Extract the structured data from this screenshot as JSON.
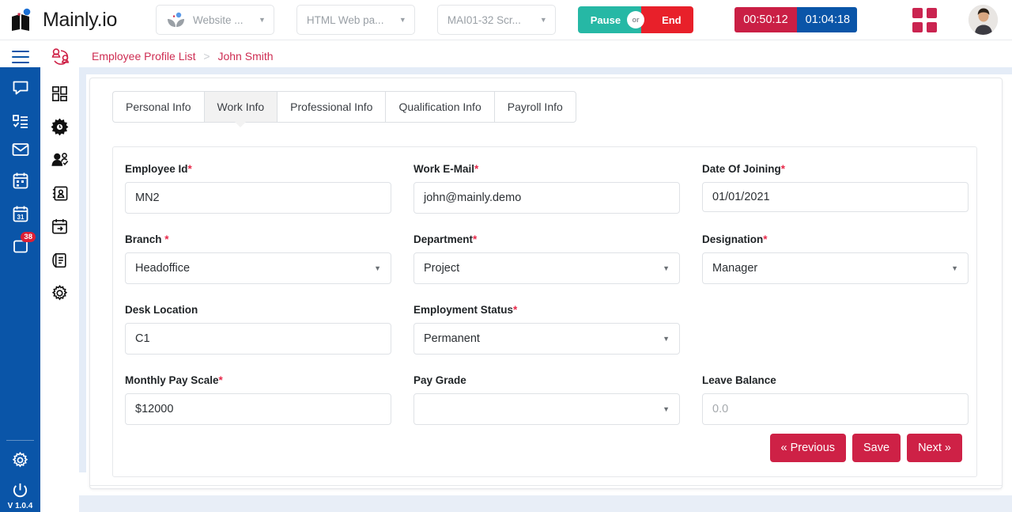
{
  "brand": {
    "name": "Mainly.io",
    "version": "V 1.0.4"
  },
  "topbar": {
    "selects": [
      {
        "name": "website-select",
        "label": "Website ...",
        "caret": "chevron-down-icon"
      },
      {
        "name": "task-type-select",
        "label": "HTML Web pa...",
        "caret": "chevron-down-icon"
      },
      {
        "name": "task-id-select",
        "label": "MAI01-32 Scr...",
        "caret": "chevron-down-icon"
      }
    ],
    "session": {
      "pause_label": "Pause",
      "or_label": "or",
      "end_label": "End"
    },
    "timers": {
      "elapsed": "00:50:12",
      "total": "01:04:18"
    },
    "apps_icon": "grid-apps-icon",
    "avatar": "user-avatar"
  },
  "sidebar": {
    "menu_icon": "hamburger-menu-icon",
    "logo_icon": "people-network-icon",
    "blue_items": [
      {
        "icon": "chat-bubble-icon",
        "label": "Chat"
      },
      {
        "icon": "task-list-icon",
        "label": "Tasks"
      },
      {
        "icon": "envelope-icon",
        "label": "Mail"
      },
      {
        "icon": "calendar-icon",
        "label": "Calendar"
      },
      {
        "icon": "calendar-31-icon",
        "label": "Schedule"
      },
      {
        "icon": "notes-icon",
        "label": "Notes",
        "badge": "38"
      }
    ],
    "white_items": [
      {
        "icon": "dashboard-grid-icon",
        "label": "Dashboard"
      },
      {
        "icon": "gear-clock-icon",
        "label": "Operations"
      },
      {
        "icon": "user-check-icon",
        "label": "Attendance"
      },
      {
        "icon": "id-card-icon",
        "label": "Employees"
      },
      {
        "icon": "calendar-leave-icon",
        "label": "Leave"
      },
      {
        "icon": "clipboard-icon",
        "label": "Reports"
      },
      {
        "icon": "settings-gear-icon",
        "label": "Settings"
      }
    ],
    "bottom_items": [
      {
        "icon": "settings-gear-icon",
        "label": "Settings"
      },
      {
        "icon": "power-icon",
        "label": "Logout"
      }
    ]
  },
  "breadcrumb": {
    "parent": "Employee Profile List",
    "separator": ">",
    "current": "John Smith"
  },
  "tabs": [
    {
      "label": "Personal Info",
      "active": false
    },
    {
      "label": "Work Info",
      "active": true
    },
    {
      "label": "Professional Info",
      "active": false
    },
    {
      "label": "Qualification Info",
      "active": false
    },
    {
      "label": "Payroll Info",
      "active": false
    }
  ],
  "form": {
    "employee_id": {
      "label": "Employee Id",
      "required": true,
      "value": "MN2",
      "type": "text"
    },
    "work_email": {
      "label": "Work E-Mail",
      "required": true,
      "value": "john@mainly.demo",
      "type": "text"
    },
    "date_of_joining": {
      "label": "Date Of Joining",
      "required": true,
      "value": "01/01/2021",
      "type": "text"
    },
    "branch": {
      "label": "Branch ",
      "required": true,
      "value": "Headoffice",
      "type": "select"
    },
    "department": {
      "label": "Department",
      "required": true,
      "value": "Project",
      "type": "select"
    },
    "designation": {
      "label": "Designation",
      "required": true,
      "value": "Manager",
      "type": "select"
    },
    "desk_location": {
      "label": "Desk Location",
      "required": false,
      "value": "C1",
      "type": "text"
    },
    "employment_status": {
      "label": "Employment Status",
      "required": true,
      "value": "Permanent",
      "type": "select"
    },
    "monthly_pay_scale": {
      "label": "Monthly Pay Scale",
      "required": true,
      "value": "$12000",
      "type": "text"
    },
    "pay_grade": {
      "label": "Pay Grade",
      "required": false,
      "value": "",
      "type": "select"
    },
    "leave_balance": {
      "label": "Leave Balance",
      "required": false,
      "value": "",
      "placeholder": "0.0",
      "type": "text"
    }
  },
  "actions": {
    "previous": "« Previous",
    "save": "Save",
    "next": "Next »"
  },
  "colors": {
    "brand_blue": "#0a55a8",
    "crimson": "#ce2146",
    "teal": "#26b8a5",
    "red": "#e8202a",
    "timer_red": "#ca1f45",
    "timer_blue": "#0a55a8"
  }
}
